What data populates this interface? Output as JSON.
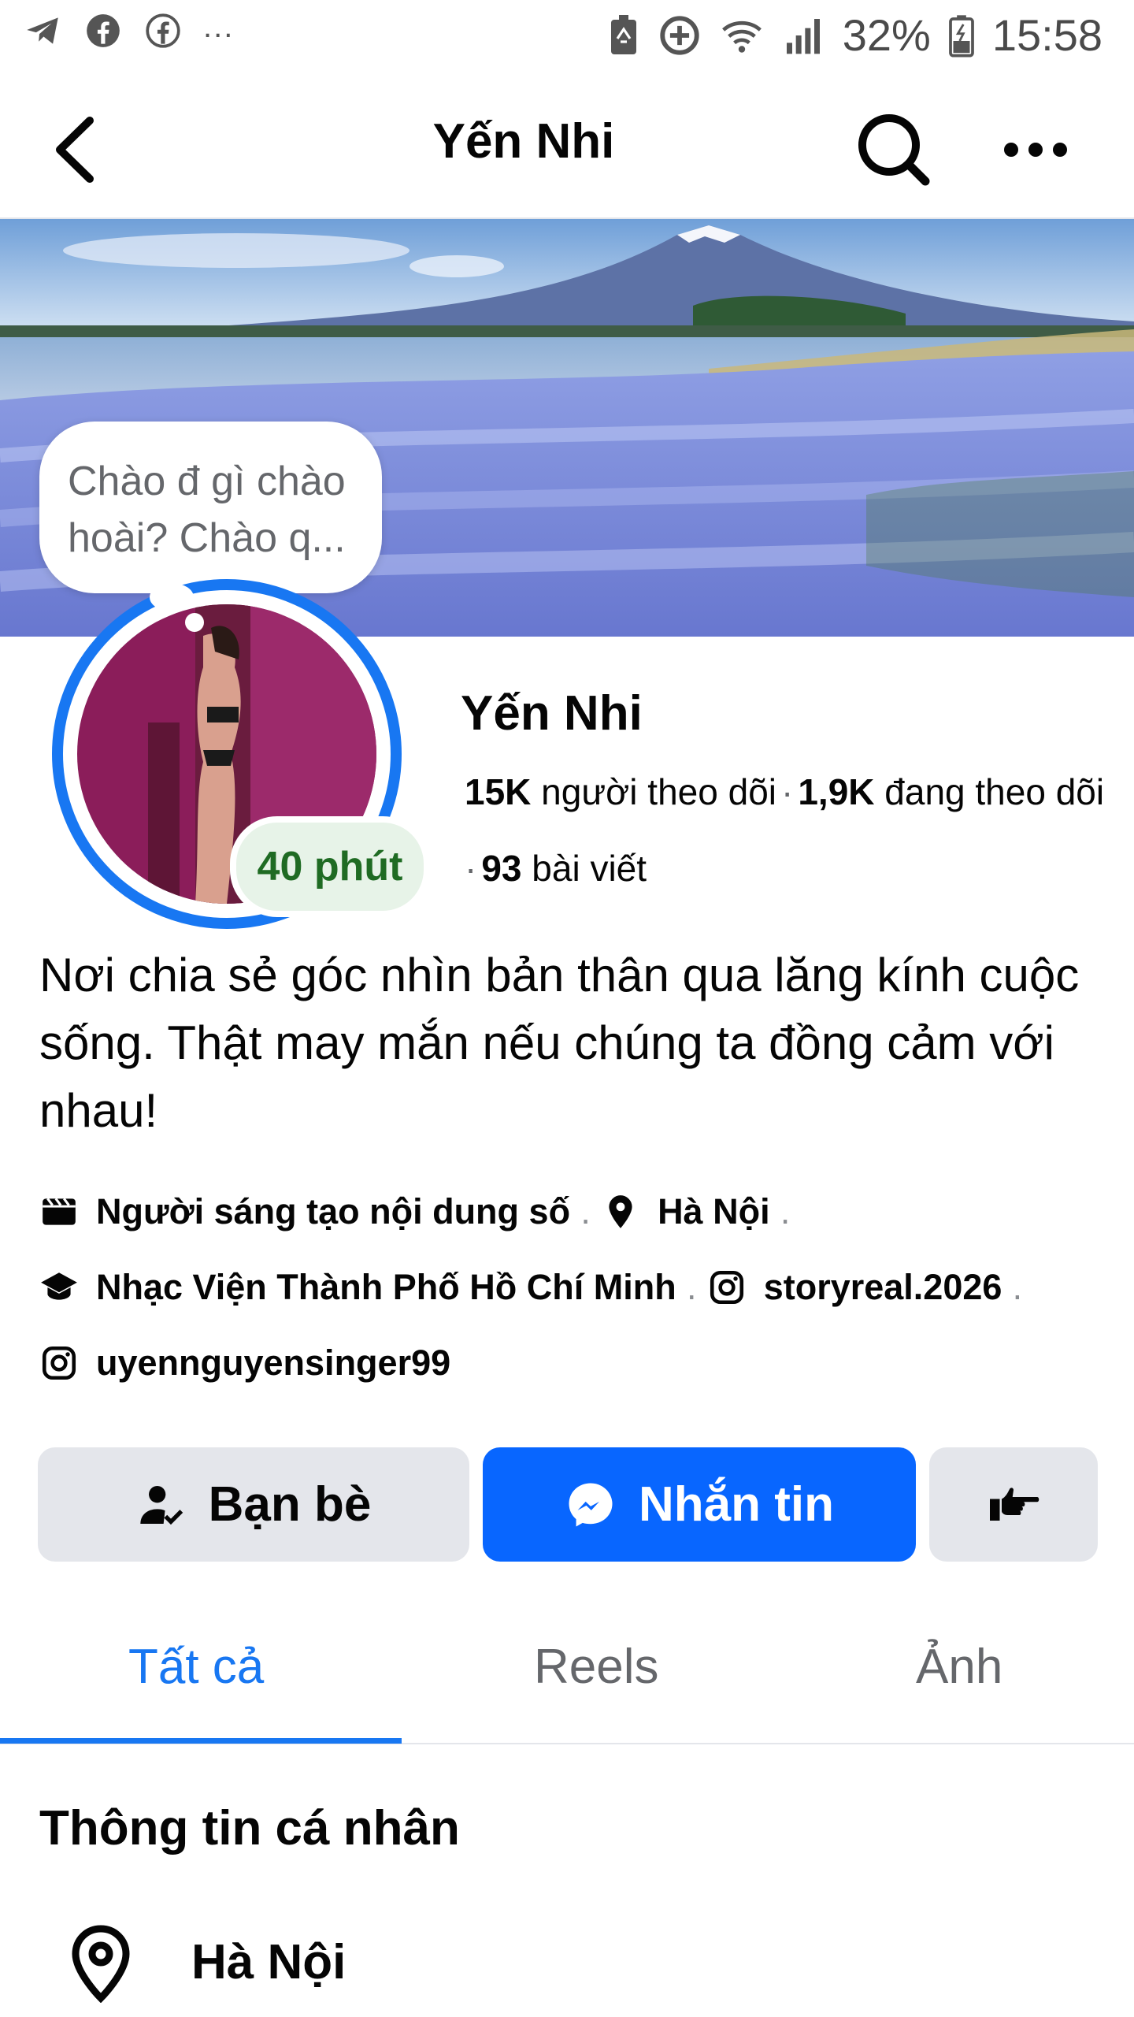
{
  "status_bar": {
    "overflow": "...",
    "battery": "32%",
    "time": "15:58"
  },
  "header": {
    "title": "Yến Nhi"
  },
  "note": {
    "text_line1": "Chào đ gì chào",
    "text_line2": "hoài? Chào q..."
  },
  "profile": {
    "name": "Yến Nhi",
    "active_label": "40 phút",
    "followers_count": "15K",
    "followers_label": "người theo dõi",
    "following_count": "1,9K",
    "following_label": "đang theo dõi",
    "posts_count": "93",
    "posts_label": "bài viết",
    "bio": "Nơi chia sẻ góc nhìn bản thân qua lăng kính cuộc sống. Thật may mắn nếu chúng ta đồng cảm với nhau!"
  },
  "details": {
    "category": "Người sáng tạo nội dung số",
    "location": "Hà Nội",
    "education": "Nhạc Viện Thành Phố Hồ Chí Minh",
    "instagram_1": "storyreal.2026",
    "instagram_2": "uyennguyensinger99"
  },
  "actions": {
    "friends_label": "Bạn bè",
    "message_label": "Nhắn tin"
  },
  "tabs": [
    {
      "label": "Tất cả",
      "active": true
    },
    {
      "label": "Reels",
      "active": false
    },
    {
      "label": "Ảnh",
      "active": false
    }
  ],
  "about": {
    "title": "Thông tin cá nhân",
    "location": "Hà Nội"
  },
  "colors": {
    "accent": "#1877f2",
    "message_button": "#0866ff",
    "secondary_button": "#e4e6eb",
    "active_badge_bg": "#e7f3e8",
    "active_badge_text": "#1f6b23"
  }
}
